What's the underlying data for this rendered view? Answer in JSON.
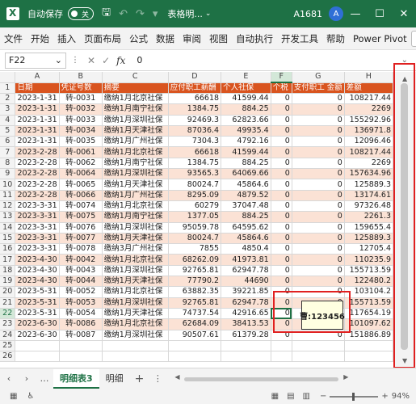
{
  "titlebar": {
    "autosave_label": "自动保存",
    "autosave_state": "关",
    "doc_title": "表格明...",
    "account": "A1681",
    "avatar_letter": "A",
    "minimize": "—",
    "maximize": "☐",
    "close": "✕"
  },
  "ribbon": {
    "tabs": [
      "文件",
      "开始",
      "插入",
      "页面布局",
      "公式",
      "数据",
      "审阅",
      "视图",
      "自动执行",
      "开发工具",
      "帮助",
      "Power Pivot"
    ]
  },
  "formula_bar": {
    "name_box": "F22",
    "cancel": "✕",
    "enter": "✓",
    "fx": "fx",
    "value": "0"
  },
  "columns": [
    "A",
    "B",
    "C",
    "D",
    "E",
    "F",
    "G",
    "H"
  ],
  "header_row": [
    "日期",
    "凭证号数",
    "摘要",
    "应付职工薪酬",
    "个人社保",
    "个税",
    "支付职工 金额",
    "差额"
  ],
  "rows": [
    [
      "2023-1-31",
      "转-0031",
      "缴纳1月北京社保",
      "66618",
      "41599.44",
      "0",
      "0",
      "108217.44"
    ],
    [
      "2023-1-31",
      "转-0032",
      "缴纳1月南宁社保",
      "1384.75",
      "884.25",
      "0",
      "0",
      "2269"
    ],
    [
      "2023-1-31",
      "转-0033",
      "缴纳1月深圳社保",
      "92469.3",
      "62823.66",
      "0",
      "0",
      "155292.96"
    ],
    [
      "2023-1-31",
      "转-0034",
      "缴纳1月天津社保",
      "87036.4",
      "49935.4",
      "0",
      "0",
      "136971.8"
    ],
    [
      "2023-1-31",
      "转-0035",
      "缴纳1月广州社保",
      "7304.3",
      "4792.16",
      "0",
      "0",
      "12096.46"
    ],
    [
      "2023-2-28",
      "转-0061",
      "缴纳1月北京社保",
      "66618",
      "41599.44",
      "0",
      "0",
      "108217.44"
    ],
    [
      "2023-2-28",
      "转-0062",
      "缴纳1月南宁社保",
      "1384.75",
      "884.25",
      "0",
      "0",
      "2269"
    ],
    [
      "2023-2-28",
      "转-0064",
      "缴纳1月深圳社保",
      "93565.3",
      "64069.66",
      "0",
      "0",
      "157634.96"
    ],
    [
      "2023-2-28",
      "转-0065",
      "缴纳1月天津社保",
      "80024.7",
      "45864.6",
      "0",
      "0",
      "125889.3"
    ],
    [
      "2023-2-28",
      "转-0066",
      "缴纳1月广州社保",
      "8295.09",
      "4879.52",
      "0",
      "0",
      "13174.61"
    ],
    [
      "2023-3-31",
      "转-0074",
      "缴纳1月北京社保",
      "60279",
      "37047.48",
      "0",
      "0",
      "97326.48"
    ],
    [
      "2023-3-31",
      "转-0075",
      "缴纳1月南宁社保",
      "1377.05",
      "884.25",
      "0",
      "0",
      "2261.3"
    ],
    [
      "2023-3-31",
      "转-0076",
      "缴纳1月深圳社保",
      "95059.78",
      "64595.62",
      "0",
      "0",
      "159655.4"
    ],
    [
      "2023-3-31",
      "转-0077",
      "缴纳1月天津社保",
      "80024.7",
      "45864.6",
      "0",
      "0",
      "125889.3"
    ],
    [
      "2023-3-31",
      "转-0078",
      "缴纳3月广州社保",
      "7855",
      "4850.4",
      "0",
      "0",
      "12705.4"
    ],
    [
      "2023-4-30",
      "转-0042",
      "缴纳1月北京社保",
      "68262.09",
      "41973.81",
      "0",
      "0",
      "110235.9"
    ],
    [
      "2023-4-30",
      "转-0043",
      "缴纳1月深圳社保",
      "92765.81",
      "62947.78",
      "0",
      "0",
      "155713.59"
    ],
    [
      "2023-4-30",
      "转-0044",
      "缴纳1月天津社保",
      "77790.2",
      "44690",
      "0",
      "0",
      "122480.2"
    ],
    [
      "2023-5-31",
      "转-0052",
      "缴纳1月北京社保",
      "63882.35",
      "39221.85",
      "0",
      "0",
      "103104.2"
    ],
    [
      "2023-5-31",
      "转-0053",
      "缴纳1月深圳社保",
      "92765.81",
      "62947.78",
      "0",
      "0",
      "155713.59"
    ],
    [
      "2023-5-31",
      "转-0054",
      "缴纳1月天津社保",
      "74737.54",
      "42916.65",
      "0",
      "0",
      "117654.19"
    ],
    [
      "2023-6-30",
      "转-0086",
      "缴纳1月北京社保",
      "62684.09",
      "38413.53",
      "0",
      "0",
      "101097.62"
    ],
    [
      "2023-6-30",
      "转-0087",
      "缴纳1月深圳社保",
      "90507.61",
      "61379.28",
      "0",
      "0",
      "151886.89"
    ]
  ],
  "row_numbers": [
    "1",
    "2",
    "3",
    "4",
    "5",
    "6",
    "7",
    "8",
    "9",
    "10",
    "11",
    "12",
    "13",
    "14",
    "15",
    "16",
    "17",
    "18",
    "19",
    "20",
    "21",
    "22",
    "23",
    "24",
    "25",
    "26"
  ],
  "comment": {
    "text": "曹:123456"
  },
  "sheet_tabs": {
    "tabs": [
      "明细表3",
      "明细"
    ],
    "active": "明细表3",
    "more": "…",
    "add": "+",
    "options": "⋮"
  },
  "statusbar": {
    "zoom_label": "94%",
    "zoom_minus": "−",
    "zoom_plus": "+"
  },
  "colors": {
    "excel_green": "#1e7145",
    "header_orange": "#d9541f",
    "band_peach": "#fbe2d5",
    "annotation_red": "#e02020"
  }
}
